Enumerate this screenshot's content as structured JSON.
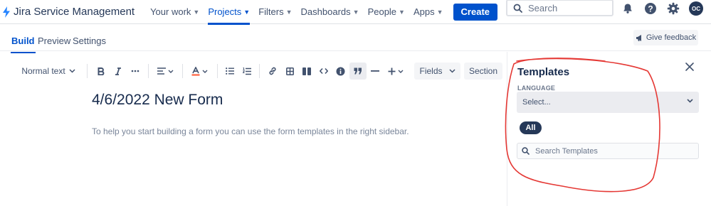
{
  "app": {
    "name": "Jira Service Management"
  },
  "nav": {
    "items": [
      {
        "label": "Your work",
        "active": false
      },
      {
        "label": "Projects",
        "active": true
      },
      {
        "label": "Filters",
        "active": false
      },
      {
        "label": "Dashboards",
        "active": false
      },
      {
        "label": "People",
        "active": false
      },
      {
        "label": "Apps",
        "active": false
      }
    ],
    "create_label": "Create",
    "search_placeholder": "Search",
    "avatar_initials": "OC"
  },
  "subtabs": {
    "items": [
      {
        "label": "Build",
        "active": true
      },
      {
        "label": "Preview",
        "active": false
      },
      {
        "label": "Settings",
        "active": false
      }
    ],
    "feedback_label": "Give feedback"
  },
  "toolbar": {
    "text_style": "Normal text",
    "fields_label": "Fields",
    "section_label": "Section"
  },
  "editor": {
    "title": "4/6/2022 New Form",
    "hint": "To help you start building a form you can use the form templates in the right sidebar."
  },
  "sidebar": {
    "title": "Templates",
    "language_label": "LANGUAGE",
    "language_placeholder": "Select...",
    "filter_pill": "All",
    "search_placeholder": "Search Templates"
  },
  "colors": {
    "brand": "#0052cc",
    "annotation": "#e53935",
    "pill": "#253858"
  }
}
